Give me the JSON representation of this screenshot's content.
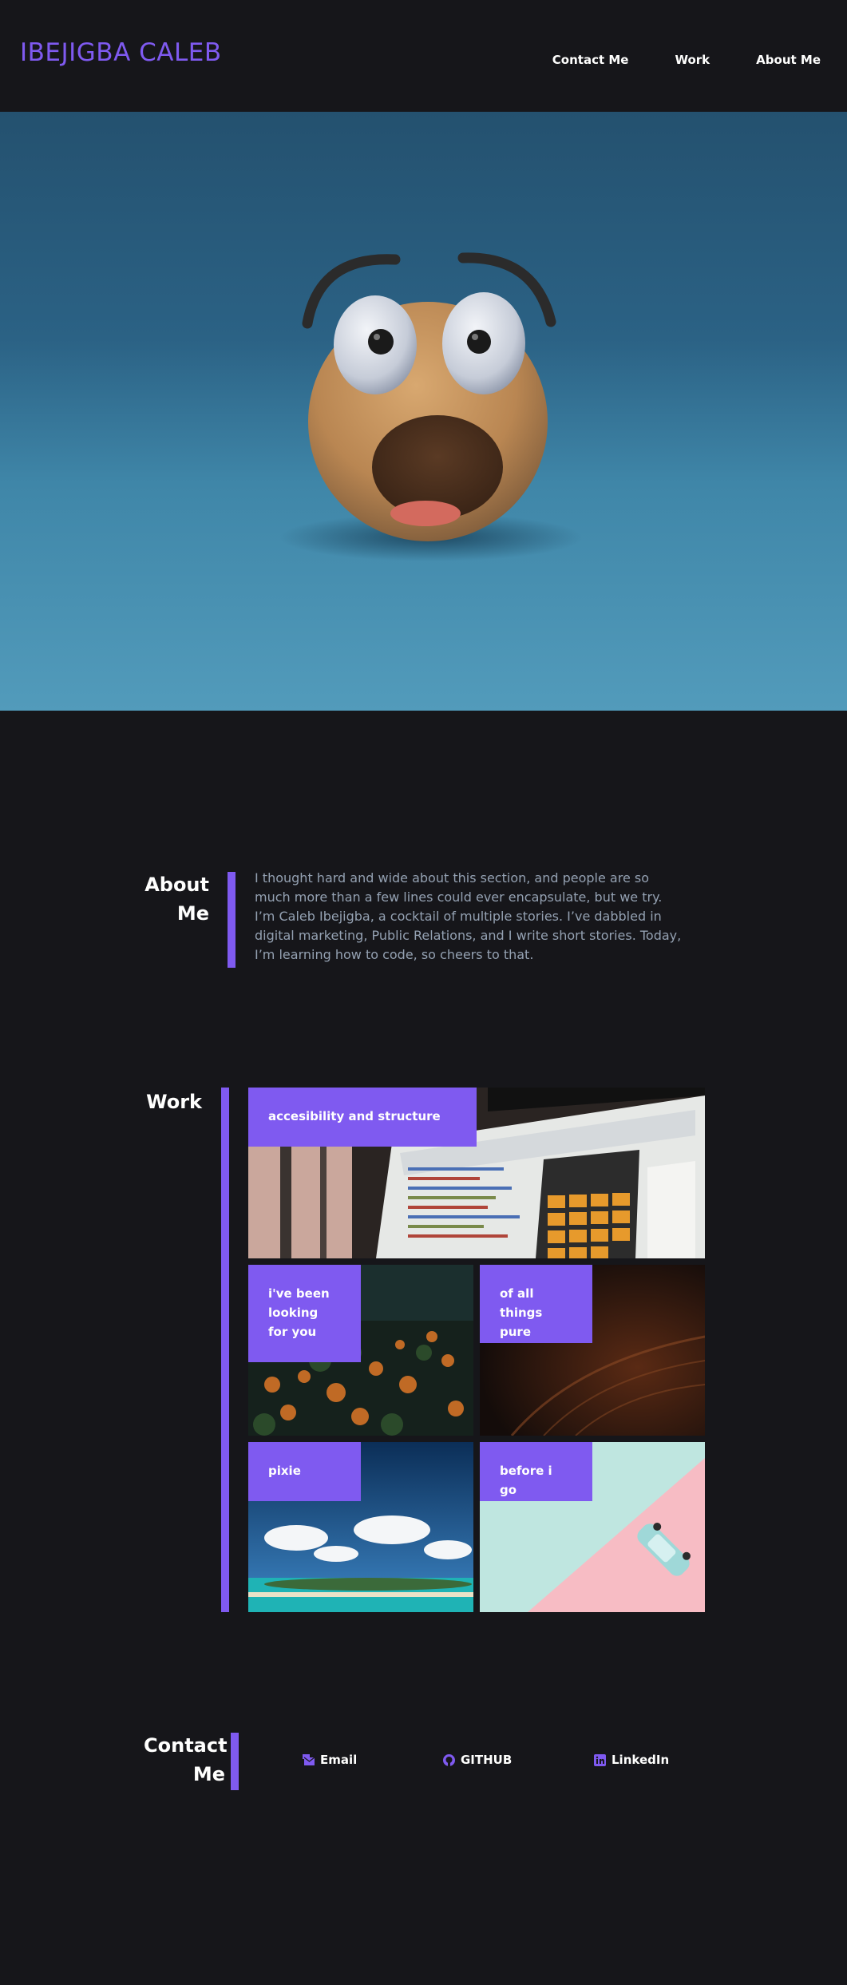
{
  "header": {
    "brand": "IBEJIGBA CALEB",
    "nav": [
      "Contact Me",
      "Work",
      "About Me"
    ]
  },
  "about": {
    "title_line1": "About",
    "title_line2": "Me",
    "text": "I thought hard and wide about this section, and people are so much more than a few lines could ever encapsulate, but we try. I’m Caleb Ibejigba, a cocktail of multiple stories. I’ve dabbled in digital marketing, Public Relations, and I write short stories. Today, I’m learning how to code, so cheers to that."
  },
  "work": {
    "title": "Work",
    "items": [
      {
        "label": "accesibility and structure"
      },
      {
        "label": "i've been looking for you"
      },
      {
        "label": "of all things pure"
      },
      {
        "label": "pixie"
      },
      {
        "label": "before i go"
      }
    ]
  },
  "contact": {
    "title_line1": "Contact",
    "title_line2": "Me",
    "links": [
      {
        "label": "Email",
        "icon": "mail-bulk-icon"
      },
      {
        "label": "GITHUB",
        "icon": "github-icon"
      },
      {
        "label": "LinkedIn",
        "icon": "linkedin-icon"
      }
    ]
  },
  "colors": {
    "background": "#16161a",
    "accent": "#7f5af0",
    "paragraph": "#94a1b2"
  }
}
